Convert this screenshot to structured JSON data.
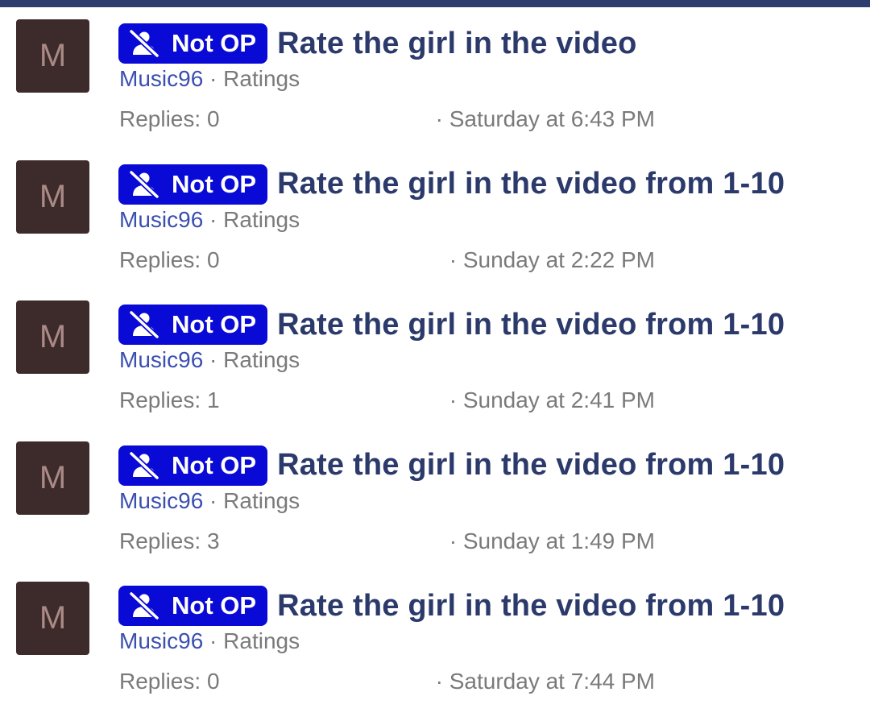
{
  "threads": [
    {
      "avatar_letter": "M",
      "badge_label": "Not OP",
      "title": "Rate the girl in the video",
      "author": "Music96",
      "separator": " · ",
      "forum": "Ratings",
      "replies": "Replies: 0",
      "date": "· Saturday at 6:43 PM"
    },
    {
      "avatar_letter": "M",
      "badge_label": "Not OP",
      "title": "Rate the girl in the video from 1-10",
      "author": "Music96",
      "separator": " · ",
      "forum": "Ratings",
      "replies": "Replies: 0",
      "date": "· Sunday at 2:22 PM"
    },
    {
      "avatar_letter": "M",
      "badge_label": "Not OP",
      "title": "Rate the girl in the video from 1-10",
      "author": "Music96",
      "separator": " · ",
      "forum": "Ratings",
      "replies": "Replies: 1",
      "date": "· Sunday at 2:41 PM"
    },
    {
      "avatar_letter": "M",
      "badge_label": "Not OP",
      "title": "Rate the girl in the video from 1-10",
      "author": "Music96",
      "separator": " · ",
      "forum": "Ratings",
      "replies": "Replies: 3",
      "date": "· Sunday at 1:49 PM"
    },
    {
      "avatar_letter": "M",
      "badge_label": "Not OP",
      "title": "Rate the girl in the video from 1-10",
      "author": "Music96",
      "separator": " · ",
      "forum": "Ratings",
      "replies": "Replies: 0",
      "date": "· Saturday at 7:44 PM"
    }
  ],
  "icons": {
    "badge_icon": "user-off-icon"
  },
  "colors": {
    "top_bar": "#2d3e6e",
    "badge_bg": "#0a0ad6",
    "title": "#2b3a6b",
    "author_link": "#3b4fb0",
    "avatar_bg": "#3d2b2b",
    "avatar_letter": "#a98a86",
    "meta_text": "#7a7a7a"
  }
}
